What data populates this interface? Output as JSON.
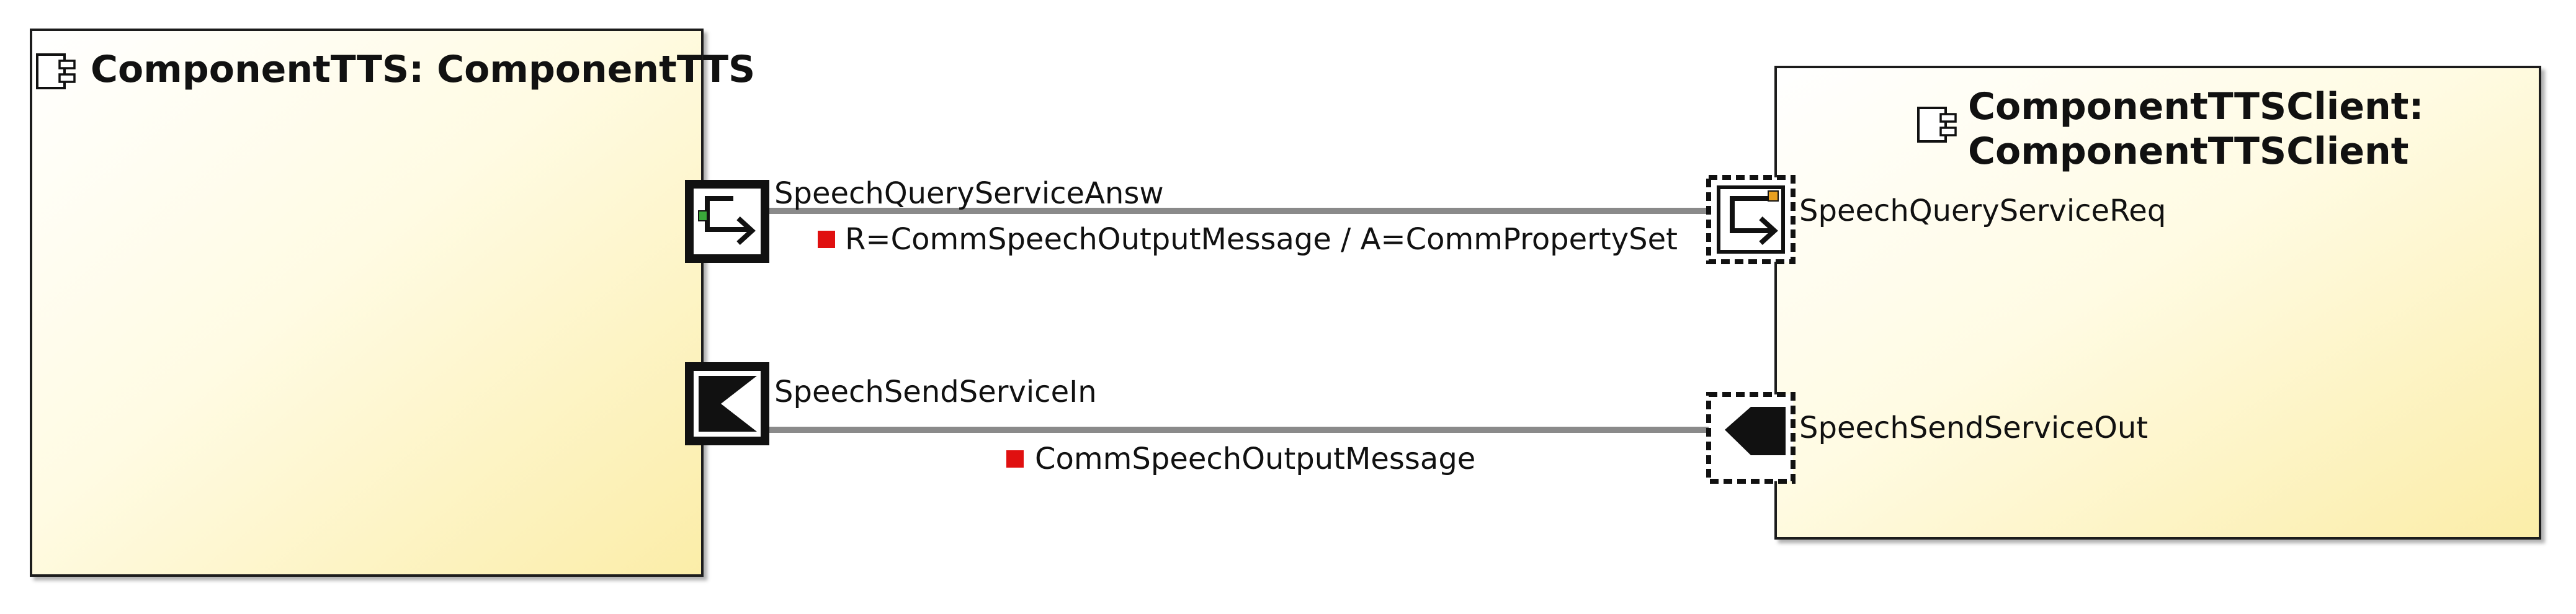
{
  "components": [
    {
      "id": "tts",
      "title": "ComponentTTS: ComponentTTS"
    },
    {
      "id": "client",
      "title_line1": "ComponentTTSClient:",
      "title_line2": "ComponentTTSClient"
    }
  ],
  "ports": {
    "answer": "SpeechQueryServiceAnsw",
    "send_in": "SpeechSendServiceIn",
    "request": "SpeechQueryServiceReq",
    "send_out": "SpeechSendServiceOut"
  },
  "connectors": {
    "query": {
      "label": "R=CommSpeechOutputMessage / A=CommPropertySet"
    },
    "send": {
      "label": "CommSpeechOutputMessage"
    }
  },
  "colors": {
    "component_fill_light": "#fffef5",
    "component_fill_dark": "#fdf0b8",
    "border": "#1a1a1a",
    "connector": "#8a8a8a",
    "marker": "#e01010",
    "port_accent": "#e8a020",
    "port_accent_green": "#3aa83a"
  }
}
